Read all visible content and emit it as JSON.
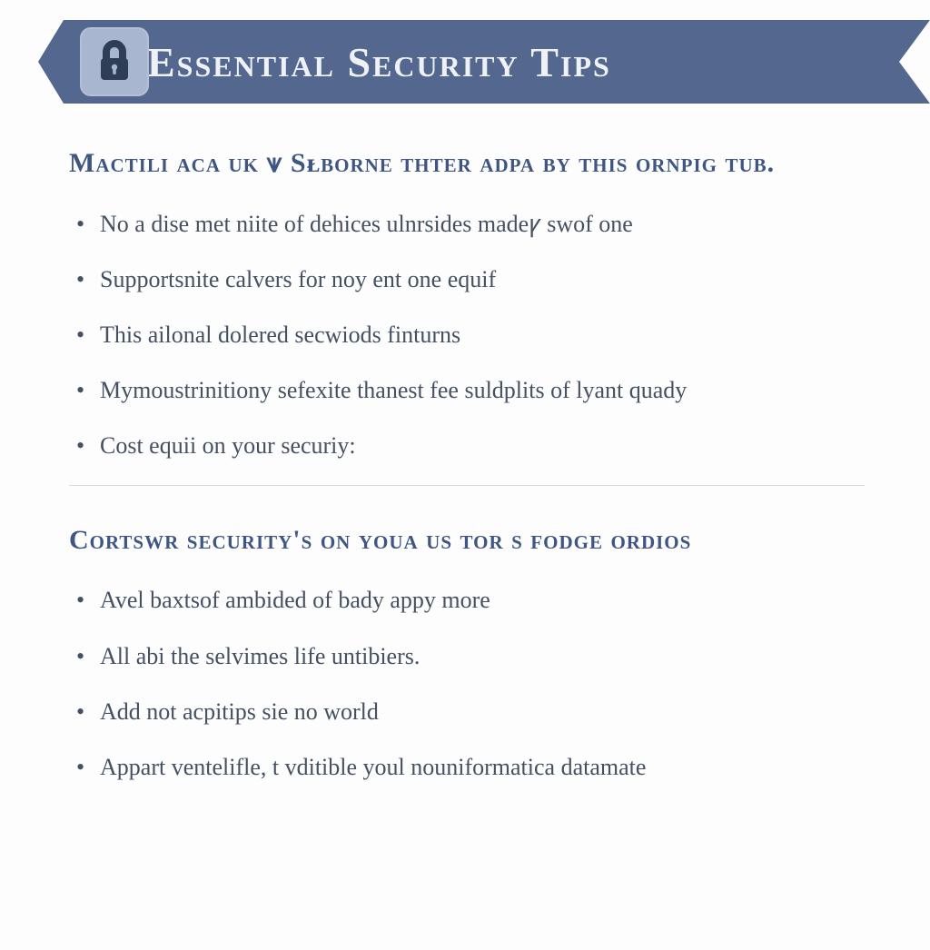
{
  "banner": {
    "title": "Essential Security Tips",
    "icon": "lock-icon"
  },
  "sections": [
    {
      "heading": "Mactili aca uk ⩛ Sᴌborne thter adpa by this ornpig tub.",
      "items": [
        "No a dise met niite of dehices ulnrsides madeꝩ swof one",
        "Supportsnite calvers for noy ent one equif",
        "This ailonal dolered secwiods finturns",
        "Mymoustrinitiony sefexite thanest fee suldplits of lyant quady",
        "Cost equii on your securiy:"
      ]
    },
    {
      "heading": "Cortswr security's on youa us tor s fodge ordios",
      "items": [
        "Avel baxtsof ambided of bady appy more",
        "All abi the selvimes life untibiers.",
        "Add not acpitips sie no world",
        "Appart ventelifle, t vditible youl nouniformatica datamate"
      ]
    }
  ]
}
